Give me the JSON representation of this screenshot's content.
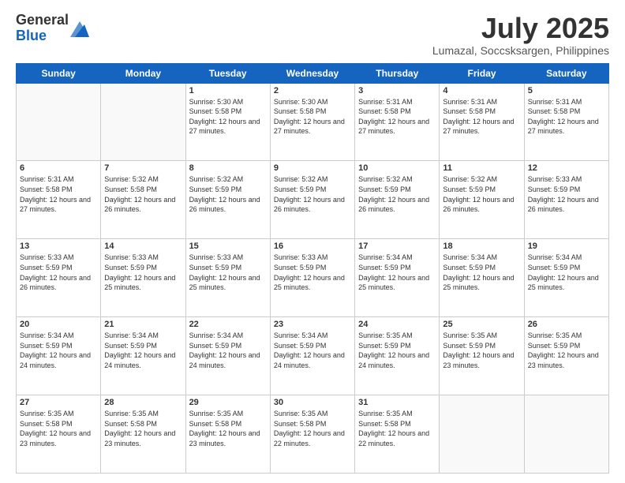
{
  "logo": {
    "general": "General",
    "blue": "Blue"
  },
  "header": {
    "month": "July 2025",
    "location": "Lumazal, Soccsksargen, Philippines"
  },
  "weekdays": [
    "Sunday",
    "Monday",
    "Tuesday",
    "Wednesday",
    "Thursday",
    "Friday",
    "Saturday"
  ],
  "weeks": [
    [
      {
        "day": "",
        "empty": true
      },
      {
        "day": "",
        "empty": true
      },
      {
        "day": "1",
        "sunrise": "5:30 AM",
        "sunset": "5:58 PM",
        "daylight": "12 hours and 27 minutes."
      },
      {
        "day": "2",
        "sunrise": "5:30 AM",
        "sunset": "5:58 PM",
        "daylight": "12 hours and 27 minutes."
      },
      {
        "day": "3",
        "sunrise": "5:31 AM",
        "sunset": "5:58 PM",
        "daylight": "12 hours and 27 minutes."
      },
      {
        "day": "4",
        "sunrise": "5:31 AM",
        "sunset": "5:58 PM",
        "daylight": "12 hours and 27 minutes."
      },
      {
        "day": "5",
        "sunrise": "5:31 AM",
        "sunset": "5:58 PM",
        "daylight": "12 hours and 27 minutes."
      }
    ],
    [
      {
        "day": "6",
        "sunrise": "5:31 AM",
        "sunset": "5:58 PM",
        "daylight": "12 hours and 27 minutes."
      },
      {
        "day": "7",
        "sunrise": "5:32 AM",
        "sunset": "5:58 PM",
        "daylight": "12 hours and 26 minutes."
      },
      {
        "day": "8",
        "sunrise": "5:32 AM",
        "sunset": "5:59 PM",
        "daylight": "12 hours and 26 minutes."
      },
      {
        "day": "9",
        "sunrise": "5:32 AM",
        "sunset": "5:59 PM",
        "daylight": "12 hours and 26 minutes."
      },
      {
        "day": "10",
        "sunrise": "5:32 AM",
        "sunset": "5:59 PM",
        "daylight": "12 hours and 26 minutes."
      },
      {
        "day": "11",
        "sunrise": "5:32 AM",
        "sunset": "5:59 PM",
        "daylight": "12 hours and 26 minutes."
      },
      {
        "day": "12",
        "sunrise": "5:33 AM",
        "sunset": "5:59 PM",
        "daylight": "12 hours and 26 minutes."
      }
    ],
    [
      {
        "day": "13",
        "sunrise": "5:33 AM",
        "sunset": "5:59 PM",
        "daylight": "12 hours and 26 minutes."
      },
      {
        "day": "14",
        "sunrise": "5:33 AM",
        "sunset": "5:59 PM",
        "daylight": "12 hours and 25 minutes."
      },
      {
        "day": "15",
        "sunrise": "5:33 AM",
        "sunset": "5:59 PM",
        "daylight": "12 hours and 25 minutes."
      },
      {
        "day": "16",
        "sunrise": "5:33 AM",
        "sunset": "5:59 PM",
        "daylight": "12 hours and 25 minutes."
      },
      {
        "day": "17",
        "sunrise": "5:34 AM",
        "sunset": "5:59 PM",
        "daylight": "12 hours and 25 minutes."
      },
      {
        "day": "18",
        "sunrise": "5:34 AM",
        "sunset": "5:59 PM",
        "daylight": "12 hours and 25 minutes."
      },
      {
        "day": "19",
        "sunrise": "5:34 AM",
        "sunset": "5:59 PM",
        "daylight": "12 hours and 25 minutes."
      }
    ],
    [
      {
        "day": "20",
        "sunrise": "5:34 AM",
        "sunset": "5:59 PM",
        "daylight": "12 hours and 24 minutes."
      },
      {
        "day": "21",
        "sunrise": "5:34 AM",
        "sunset": "5:59 PM",
        "daylight": "12 hours and 24 minutes."
      },
      {
        "day": "22",
        "sunrise": "5:34 AM",
        "sunset": "5:59 PM",
        "daylight": "12 hours and 24 minutes."
      },
      {
        "day": "23",
        "sunrise": "5:34 AM",
        "sunset": "5:59 PM",
        "daylight": "12 hours and 24 minutes."
      },
      {
        "day": "24",
        "sunrise": "5:35 AM",
        "sunset": "5:59 PM",
        "daylight": "12 hours and 24 minutes."
      },
      {
        "day": "25",
        "sunrise": "5:35 AM",
        "sunset": "5:59 PM",
        "daylight": "12 hours and 23 minutes."
      },
      {
        "day": "26",
        "sunrise": "5:35 AM",
        "sunset": "5:59 PM",
        "daylight": "12 hours and 23 minutes."
      }
    ],
    [
      {
        "day": "27",
        "sunrise": "5:35 AM",
        "sunset": "5:58 PM",
        "daylight": "12 hours and 23 minutes."
      },
      {
        "day": "28",
        "sunrise": "5:35 AM",
        "sunset": "5:58 PM",
        "daylight": "12 hours and 23 minutes."
      },
      {
        "day": "29",
        "sunrise": "5:35 AM",
        "sunset": "5:58 PM",
        "daylight": "12 hours and 23 minutes."
      },
      {
        "day": "30",
        "sunrise": "5:35 AM",
        "sunset": "5:58 PM",
        "daylight": "12 hours and 22 minutes."
      },
      {
        "day": "31",
        "sunrise": "5:35 AM",
        "sunset": "5:58 PM",
        "daylight": "12 hours and 22 minutes."
      },
      {
        "day": "",
        "empty": true
      },
      {
        "day": "",
        "empty": true
      }
    ]
  ]
}
